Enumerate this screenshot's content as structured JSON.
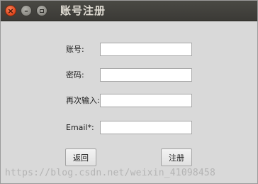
{
  "window": {
    "title": "账号注册",
    "close_glyph": "×",
    "minimize_glyph": "–"
  },
  "form": {
    "account_label": "账号:",
    "password_label": "密码:",
    "confirm_label": "再次输入:",
    "email_label": "Email*:",
    "account_value": "",
    "password_value": "",
    "confirm_value": "",
    "email_value": ""
  },
  "buttons": {
    "back_label": "返回",
    "register_label": "注册"
  },
  "watermark": "https://blog.csdn.net/weixin_41098458"
}
